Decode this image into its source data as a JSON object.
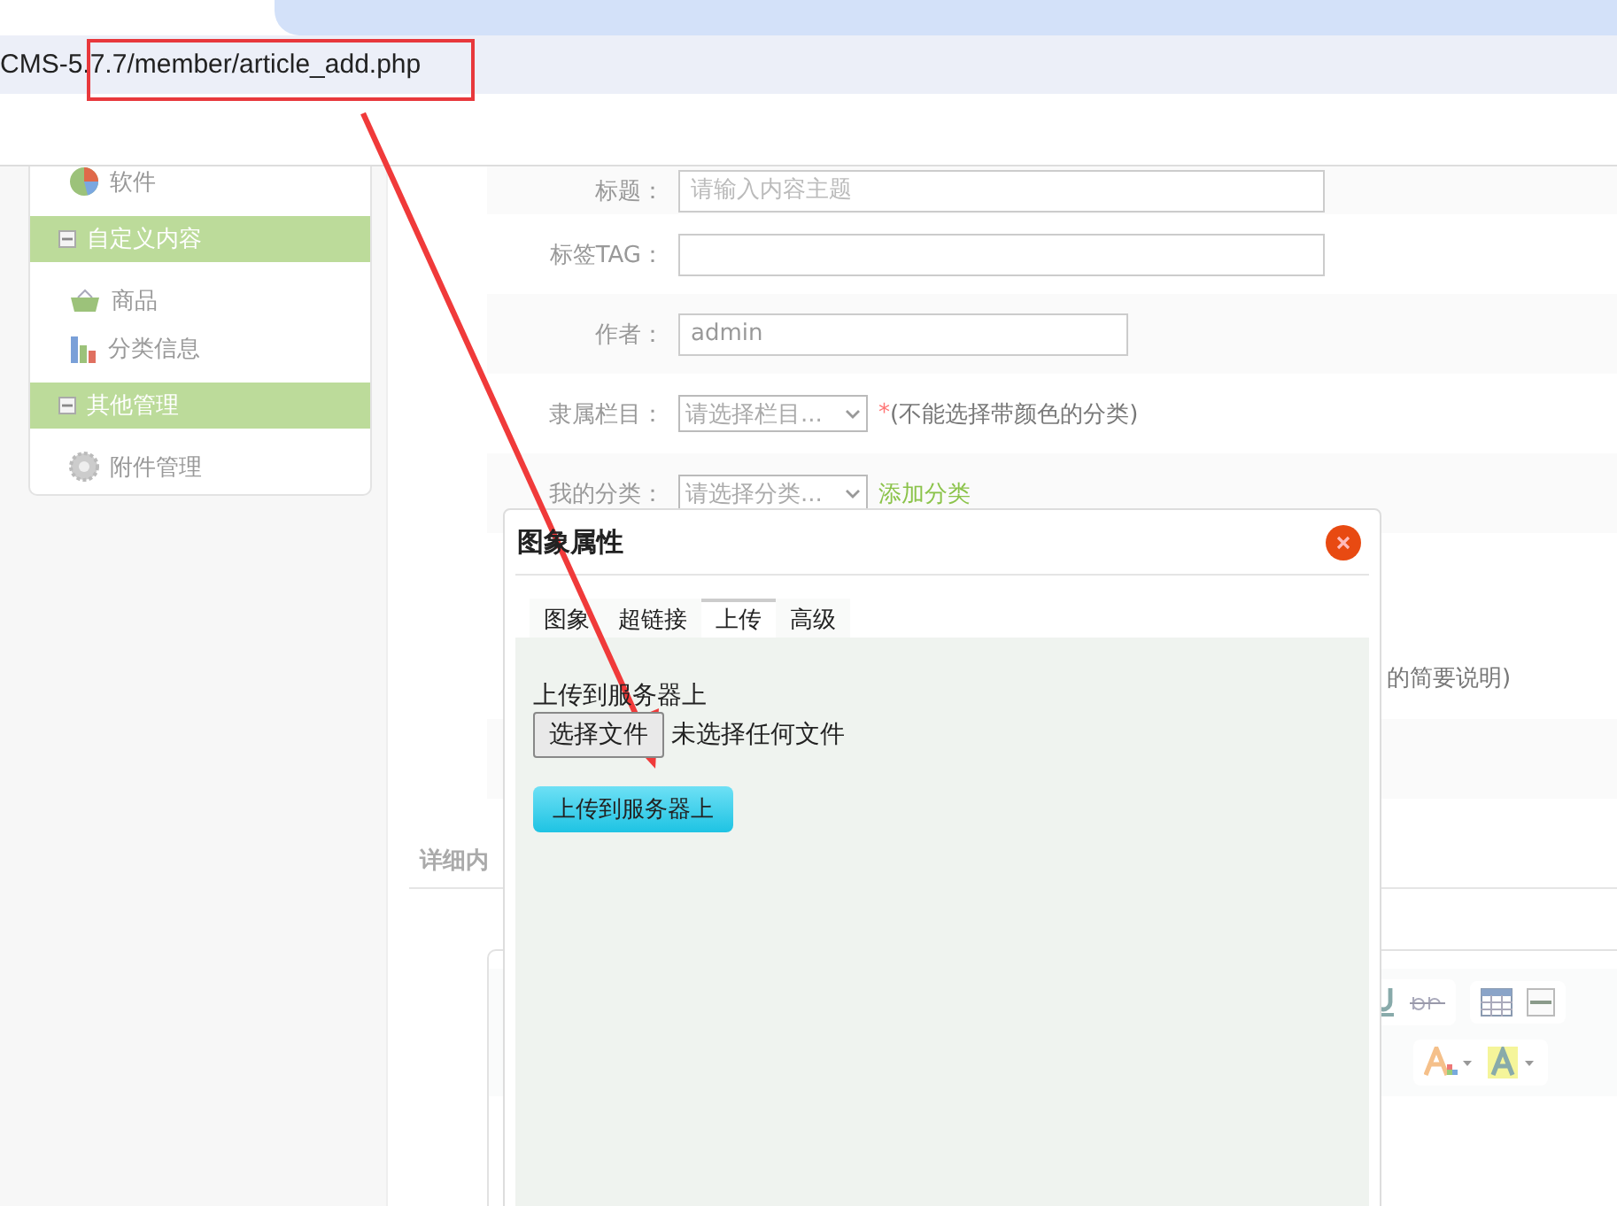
{
  "browser": {
    "url": "CMS-5.7.7/member/article_add.php"
  },
  "sidebar": {
    "items": [
      {
        "kind": "item",
        "label": "软件"
      },
      {
        "kind": "group",
        "label": "自定义内容",
        "expanded": true
      },
      {
        "kind": "item",
        "label": "商品"
      },
      {
        "kind": "item",
        "label": "分类信息"
      },
      {
        "kind": "group",
        "label": "其他管理",
        "expanded": true
      },
      {
        "kind": "item",
        "label": "附件管理"
      }
    ]
  },
  "form": {
    "rows": [
      {
        "kind": "text",
        "label": "标题：",
        "placeholder": "请输入内容主题"
      },
      {
        "kind": "text",
        "label": "标签TAG："
      },
      {
        "kind": "short",
        "label": "作者：",
        "value": "admin"
      },
      {
        "kind": "select",
        "label": "隶属栏目：",
        "value": "请选择栏目...",
        "mark": "*",
        "note": "(不能选择带颜色的分类)"
      },
      {
        "kind": "select",
        "label": "我的分类：",
        "value": "请选择分类...",
        "link": "添加分类"
      },
      {
        "kind": "hidden",
        "note": "的简要说明)"
      },
      {
        "kind": "blank"
      }
    ],
    "section_title": "详细内"
  },
  "dialog": {
    "title": "图象属性",
    "tabs": [
      {
        "label": "图象",
        "selected": false
      },
      {
        "label": "超链接",
        "selected": false
      },
      {
        "label": "上传",
        "selected": true
      },
      {
        "label": "高级",
        "selected": false
      }
    ],
    "upload_label": "上传到服务器上",
    "file_button": "选择文件",
    "file_status": "未选择任何文件",
    "submit": "上传到服务器上"
  }
}
